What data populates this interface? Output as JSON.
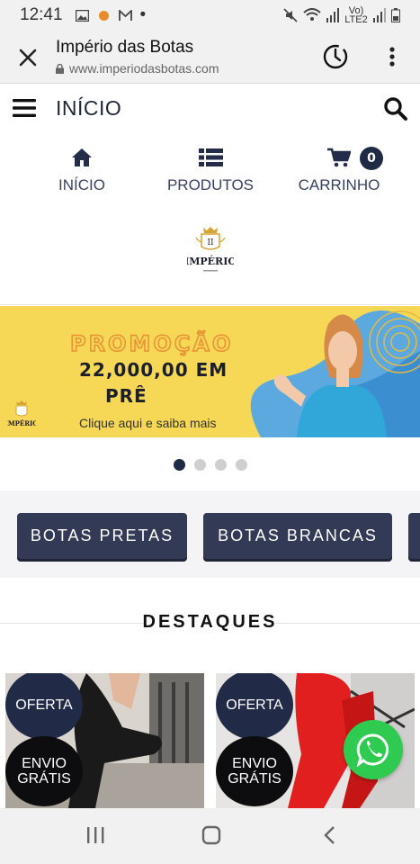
{
  "status_bar": {
    "time": "12:41",
    "dot": "•",
    "volte": "Vo) LTE2"
  },
  "browser": {
    "page_title": "Império das Botas",
    "url": "www.imperiodasbotas.com"
  },
  "site_header": {
    "title": "INÍCIO"
  },
  "nav": [
    {
      "label": "INÍCIO",
      "icon": "home-icon"
    },
    {
      "label": "PRODUTOS",
      "icon": "list-icon"
    },
    {
      "label": "CARRINHO",
      "icon": "cart-icon"
    }
  ],
  "cart_count": "0",
  "logo_text": "IMPÉRIO",
  "banner": {
    "headline": "PROMOÇÃO",
    "price": "22,000,00 EM",
    "price_suffix": "PRÊ",
    "cta": "Clique aqui e saiba mais"
  },
  "carousel": {
    "total": 4,
    "active": 0
  },
  "categories": [
    "BOTAS PRETAS",
    "BOTAS BRANCAS"
  ],
  "section_title": "DESTAQUES",
  "products": [
    {
      "offer_tag": "OFERTA",
      "shipping_tag": "ENVIO GRÁTIS"
    },
    {
      "offer_tag": "OFERTA",
      "shipping_tag": "ENVIO GRÁTIS"
    }
  ],
  "colors": {
    "navy": "#212a46",
    "banner_yellow": "#f6d756",
    "whatsapp_green": "#2ecb50"
  }
}
